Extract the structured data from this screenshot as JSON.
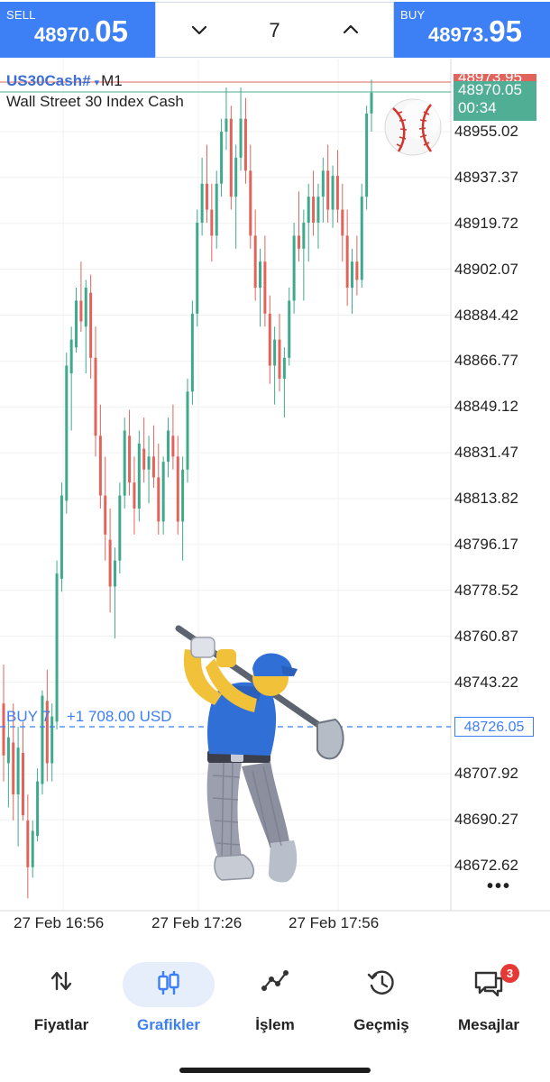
{
  "trade_bar": {
    "sell_caption": "SELL",
    "sell_price_main": "48970.",
    "sell_price_big": "05",
    "lot_value": "7",
    "buy_caption": "BUY",
    "buy_price_main": "48973.",
    "buy_price_big": "95"
  },
  "chart": {
    "symbol": "US30Cash#",
    "caret": "▾",
    "timeframe": "M1",
    "description": "Wall Street 30 Index Cash",
    "ask_label": "48973.95",
    "bid_label": "48970.05",
    "countdown": "00:34",
    "price_axis": [
      "48955.02",
      "48937.37",
      "48919.72",
      "48902.07",
      "48884.42",
      "48866.77",
      "48849.12",
      "48831.47",
      "48813.82",
      "48796.17",
      "48778.52",
      "48760.87",
      "48743.22",
      "48707.92",
      "48690.27",
      "48672.62"
    ],
    "position": {
      "label": "BUY 7",
      "profit": "+1 708.00 USD",
      "price": "48726.05"
    },
    "time_axis": [
      "27 Feb 16:56",
      "27 Feb 17:26",
      "27 Feb 17:56"
    ],
    "colors": {
      "bull": "#3fa98b",
      "bear": "#e0645c",
      "accent": "#3d7ff5"
    },
    "candles": [
      [
        48735,
        48750,
        48705,
        48715
      ],
      [
        48712,
        48730,
        48695,
        48722
      ],
      [
        48720,
        48735,
        48690,
        48700
      ],
      [
        48700,
        48726,
        48680,
        48718
      ],
      [
        48716,
        48728,
        48690,
        48692
      ],
      [
        48690,
        48700,
        48660,
        48672
      ],
      [
        48672,
        48690,
        48668,
        48686
      ],
      [
        48684,
        48710,
        48682,
        48705
      ],
      [
        48704,
        48740,
        48700,
        48738
      ],
      [
        48736,
        48748,
        48705,
        48712
      ],
      [
        48712,
        48735,
        48705,
        48730
      ],
      [
        48728,
        48790,
        48725,
        48785
      ],
      [
        48783,
        48820,
        48778,
        48815
      ],
      [
        48813,
        48870,
        48808,
        48865
      ],
      [
        48862,
        48880,
        48840,
        48875
      ],
      [
        48872,
        48895,
        48870,
        48890
      ],
      [
        48890,
        48905,
        48878,
        48882
      ],
      [
        48880,
        48898,
        48862,
        48895
      ],
      [
        48893,
        48900,
        48860,
        48868
      ],
      [
        48868,
        48880,
        48830,
        48838
      ],
      [
        48838,
        48850,
        48810,
        48815
      ],
      [
        48815,
        48830,
        48790,
        48800
      ],
      [
        48798,
        48810,
        48770,
        48780
      ],
      [
        48780,
        48795,
        48760,
        48790
      ],
      [
        48790,
        48820,
        48785,
        48815
      ],
      [
        48815,
        48845,
        48810,
        48840
      ],
      [
        48838,
        48848,
        48815,
        48820
      ],
      [
        48820,
        48830,
        48800,
        48810
      ],
      [
        48810,
        48840,
        48805,
        48835
      ],
      [
        48833,
        48845,
        48820,
        48825
      ],
      [
        48825,
        48838,
        48812,
        48830
      ],
      [
        48830,
        48842,
        48818,
        48822
      ],
      [
        48822,
        48835,
        48800,
        48805
      ],
      [
        48805,
        48830,
        48800,
        48828
      ],
      [
        48828,
        48845,
        48822,
        48840
      ],
      [
        48838,
        48850,
        48825,
        48830
      ],
      [
        48830,
        48838,
        48800,
        48805
      ],
      [
        48805,
        48830,
        48790,
        48825
      ],
      [
        48825,
        48860,
        48820,
        48855
      ],
      [
        48855,
        48890,
        48850,
        48885
      ],
      [
        48885,
        48925,
        48880,
        48920
      ],
      [
        48920,
        48945,
        48915,
        48935
      ],
      [
        48935,
        48950,
        48920,
        48925
      ],
      [
        48925,
        48935,
        48905,
        48915
      ],
      [
        48915,
        48940,
        48910,
        48935
      ],
      [
        48935,
        48960,
        48930,
        48955
      ],
      [
        48955,
        48972,
        48948,
        48960
      ],
      [
        48960,
        48965,
        48925,
        48930
      ],
      [
        48930,
        48950,
        48910,
        48945
      ],
      [
        48945,
        48972,
        48940,
        48960
      ],
      [
        48960,
        48968,
        48935,
        48940
      ],
      [
        48940,
        48950,
        48910,
        48915
      ],
      [
        48915,
        48925,
        48890,
        48895
      ],
      [
        48895,
        48910,
        48880,
        48905
      ],
      [
        48905,
        48915,
        48880,
        48885
      ],
      [
        48885,
        48892,
        48858,
        48865
      ],
      [
        48865,
        48880,
        48850,
        48875
      ],
      [
        48875,
        48885,
        48855,
        48860
      ],
      [
        48860,
        48872,
        48845,
        48868
      ],
      [
        48868,
        48895,
        48865,
        48890
      ],
      [
        48890,
        48920,
        48885,
        48915
      ],
      [
        48915,
        48932,
        48905,
        48910
      ],
      [
        48910,
        48925,
        48890,
        48920
      ],
      [
        48920,
        48935,
        48905,
        48930
      ],
      [
        48930,
        48940,
        48915,
        48920
      ],
      [
        48920,
        48935,
        48910,
        48930
      ],
      [
        48930,
        48945,
        48920,
        48940
      ],
      [
        48940,
        48950,
        48920,
        48925
      ],
      [
        48925,
        48942,
        48918,
        48938
      ],
      [
        48938,
        48948,
        48920,
        48925
      ],
      [
        48925,
        48935,
        48905,
        48915
      ],
      [
        48915,
        48925,
        48888,
        48895
      ],
      [
        48895,
        48910,
        48885,
        48905
      ],
      [
        48905,
        48915,
        48892,
        48898
      ],
      [
        48898,
        48935,
        48895,
        48930
      ],
      [
        48930,
        48965,
        48925,
        48962
      ],
      [
        48962,
        48975,
        48955,
        48970
      ]
    ]
  },
  "nav": {
    "items": [
      {
        "label": "Fiyatlar"
      },
      {
        "label": "Grafikler"
      },
      {
        "label": "İşlem"
      },
      {
        "label": "Geçmiş"
      },
      {
        "label": "Mesajlar",
        "badge": "3"
      }
    ]
  }
}
